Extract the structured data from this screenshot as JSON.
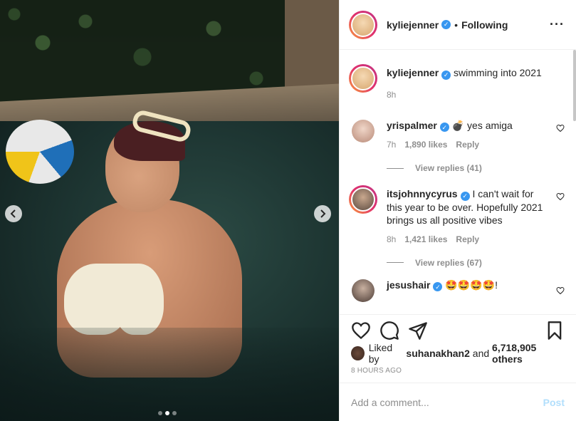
{
  "post": {
    "username": "kyliejenner",
    "follow_separator": "•",
    "follow_label": "Following",
    "more_icon": "more-options-icon",
    "caption": {
      "username": "kyliejenner",
      "text": "swimming into 2021",
      "time": "8h"
    }
  },
  "comments": [
    {
      "username": "yrispalmer",
      "text": "💣 yes amiga",
      "time": "7h",
      "likes": "1,890 likes",
      "reply_label": "Reply",
      "view_replies": "View replies (41)"
    },
    {
      "username": "itsjohnnycyrus",
      "text": "I can't wait for this year to be over. Hopefully 2021 brings us all positive vibes",
      "time": "8h",
      "likes": "1,421 likes",
      "reply_label": "Reply",
      "view_replies": "View replies (67)"
    },
    {
      "username": "jesushair",
      "text": "🤩🤩🤩🤩!"
    }
  ],
  "actions": {
    "like_icon": "heart-icon",
    "comment_icon": "comment-icon",
    "share_icon": "share-icon",
    "save_icon": "bookmark-icon"
  },
  "likes": {
    "prefix": "Liked by",
    "user": "suhanakhan2",
    "conjunction": "and",
    "count": "6,718,905 others"
  },
  "timestamp": "8 HOURS AGO",
  "add_comment": {
    "placeholder": "Add a comment...",
    "post_label": "Post"
  },
  "carousel": {
    "prev_icon": "chevron-left-icon",
    "next_icon": "chevron-right-icon",
    "dots_count": 3,
    "active_dot": 2
  },
  "colors": {
    "verified": "#3897f0",
    "post_disabled": "#b2dffc",
    "meta": "#8e8e8e"
  }
}
